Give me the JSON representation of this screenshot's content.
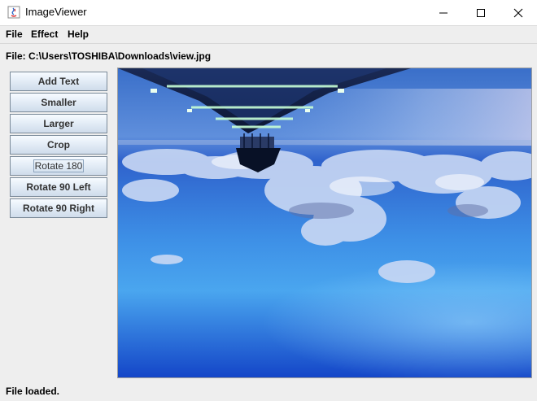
{
  "window": {
    "title": "ImageViewer",
    "controls": [
      "minimize-icon",
      "maximize-icon",
      "close-icon"
    ]
  },
  "menubar": {
    "items": [
      "File",
      "Effect",
      "Help"
    ]
  },
  "file_label": "File: C:\\Users\\TOSHIBA\\Downloads\\view.jpg",
  "toolbar": {
    "buttons": [
      {
        "label": "Add Text"
      },
      {
        "label": "Smaller"
      },
      {
        "label": "Larger"
      },
      {
        "label": "Crop"
      },
      {
        "label": "Rotate 180",
        "focused": true
      },
      {
        "label": "Rotate 90 Left"
      },
      {
        "label": "Rotate 90 Right"
      }
    ]
  },
  "image": {
    "description_icon": "landscape-image",
    "orientation": "upside-down"
  },
  "status": "File loaded.",
  "colors": {
    "sky_deep": "#1146c4",
    "sky_light": "#5eb3f0",
    "button_border": "#7a8a99"
  }
}
